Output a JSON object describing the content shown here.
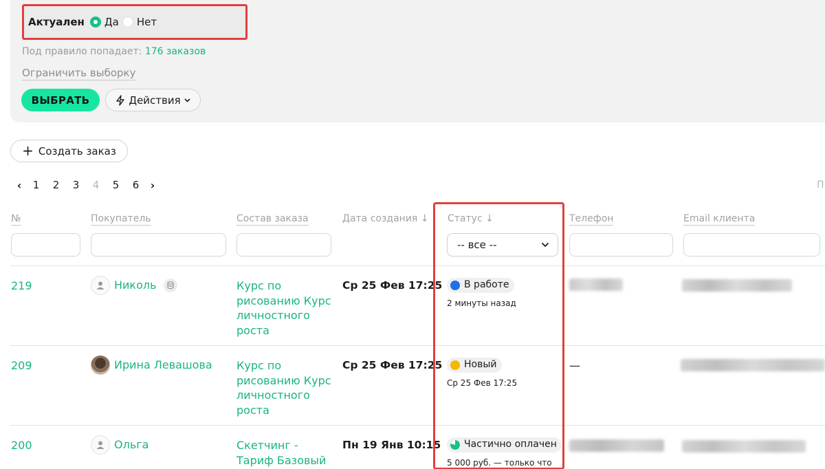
{
  "filter": {
    "active_label": "Актуален",
    "option_yes": "Да",
    "option_no": "Нет",
    "selected": "Да",
    "rule_prefix": "Под правило попадает:",
    "rule_count": "176 заказов",
    "limit_link": "Ограничить выборку",
    "select_button": "ВЫБРАТЬ",
    "actions_button": "Действия"
  },
  "toolbar": {
    "create_order": "Создать заказ"
  },
  "pagination": {
    "pages": [
      "1",
      "2",
      "3",
      "4",
      "5",
      "6"
    ],
    "current": "4",
    "edge_text": "П"
  },
  "table": {
    "headers": {
      "number": "№",
      "buyer": "Покупатель",
      "order": "Состав заказа",
      "created": "Дата создания ↓",
      "status": "Статус ↓",
      "phone": "Телефон",
      "email": "Email клиента"
    },
    "status_filter": "-- все --",
    "rows": [
      {
        "number": "219",
        "buyer": "Николь",
        "order": "Курс по рисованию Курс личностного роста",
        "date": "Ср 25 Фев 17:25",
        "status": "В работе",
        "status_color": "#1f6fe8",
        "status_sub": "2 минуты назад",
        "phone": "",
        "email": ""
      },
      {
        "number": "209",
        "buyer": "Ирина Левашова",
        "order": "Курс по рисованию Курс личностного роста",
        "date": "Ср 25 Фев 17:25",
        "status": "Новый",
        "status_color": "#f5b800",
        "status_sub": "Ср 25 Фев 17:25",
        "phone": "—",
        "email": ""
      },
      {
        "number": "200",
        "buyer": "Ольга",
        "order": "Скетчинг - Тариф Базовый",
        "date": "Пн 19 Янв 10:15",
        "status": "Частично оплачен",
        "status_color": "#18c08c",
        "status_sub": "5 000 руб. — только что",
        "phone": "",
        "email": ""
      }
    ]
  }
}
